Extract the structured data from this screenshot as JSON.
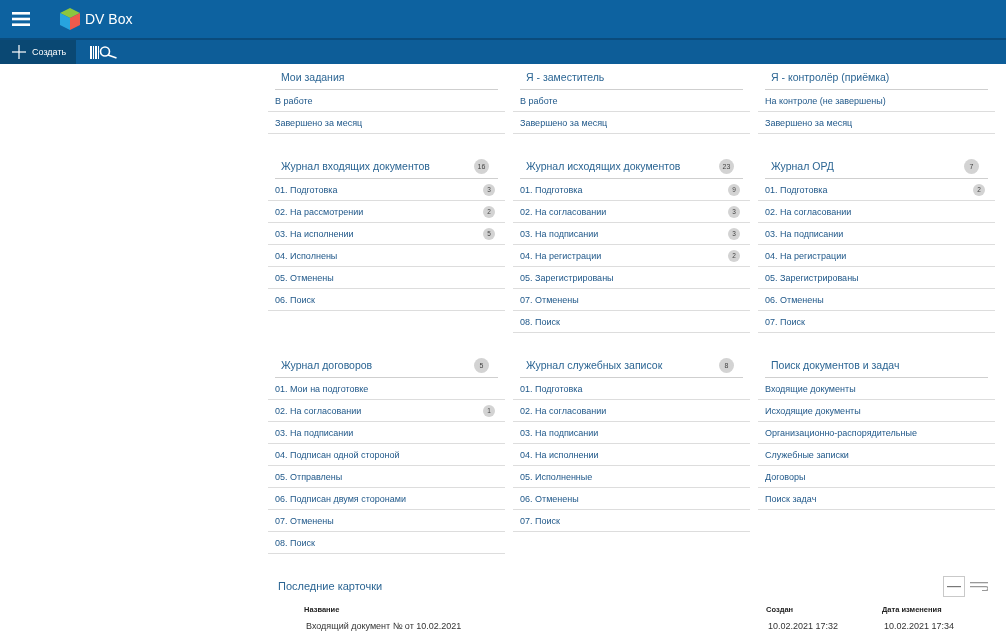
{
  "header": {
    "app_name": "DV Box"
  },
  "toolbar": {
    "create_label": "Создать"
  },
  "sections": [
    {
      "title": "Мои задания",
      "items": [
        {
          "label": "В работе"
        },
        {
          "label": "Завершено за месяц"
        }
      ]
    },
    {
      "title": "Я - заместитель",
      "items": [
        {
          "label": "В работе"
        },
        {
          "label": "Завершено за месяц"
        }
      ]
    },
    {
      "title": "Я - контролёр (приёмка)",
      "items": [
        {
          "label": "На контроле (не завершены)"
        },
        {
          "label": "Завершено за месяц"
        }
      ]
    },
    {
      "title": "Журнал входящих документов",
      "count": "16",
      "items": [
        {
          "label": "01. Подготовка",
          "count": "3"
        },
        {
          "label": "02. На рассмотрении",
          "count": "2"
        },
        {
          "label": "03. На исполнении",
          "count": "5"
        },
        {
          "label": "04. Исполнены"
        },
        {
          "label": "05. Отменены"
        },
        {
          "label": "06. Поиск"
        }
      ]
    },
    {
      "title": "Журнал исходящих документов",
      "count": "23",
      "items": [
        {
          "label": "01. Подготовка",
          "count": "9"
        },
        {
          "label": "02. На согласовании",
          "count": "3"
        },
        {
          "label": "03. На подписании",
          "count": "3"
        },
        {
          "label": "04. На регистрации",
          "count": "2"
        },
        {
          "label": "05. Зарегистрированы"
        },
        {
          "label": "07. Отменены"
        },
        {
          "label": "08. Поиск"
        }
      ]
    },
    {
      "title": "Журнал ОРД",
      "count": "7",
      "items": [
        {
          "label": "01. Подготовка",
          "count": "2"
        },
        {
          "label": "02. На согласовании"
        },
        {
          "label": "03. На подписании"
        },
        {
          "label": "04. На регистрации"
        },
        {
          "label": "05. Зарегистрированы"
        },
        {
          "label": "06. Отменены"
        },
        {
          "label": "07. Поиск"
        }
      ]
    },
    {
      "title": "Журнал договоров",
      "count": "5",
      "items": [
        {
          "label": "01. Мои на подготовке"
        },
        {
          "label": "02. На согласовании",
          "count": "1"
        },
        {
          "label": "03. На подписании"
        },
        {
          "label": "04. Подписан одной стороной"
        },
        {
          "label": "05. Отправлены"
        },
        {
          "label": "06. Подписан двумя сторонами"
        },
        {
          "label": "07. Отменены"
        },
        {
          "label": "08. Поиск"
        }
      ]
    },
    {
      "title": "Журнал служебных записок",
      "count": "8",
      "items": [
        {
          "label": "01. Подготовка"
        },
        {
          "label": "02. На согласовании"
        },
        {
          "label": "03. На подписании"
        },
        {
          "label": "04. На исполнении"
        },
        {
          "label": "05. Исполненные"
        },
        {
          "label": "06. Отменены"
        },
        {
          "label": "07. Поиск"
        }
      ]
    },
    {
      "title": "Поиск документов и задач",
      "items": [
        {
          "label": "Входящие документы"
        },
        {
          "label": "Исходящие документы"
        },
        {
          "label": "Организационно-распорядительные"
        },
        {
          "label": "Служебные записки"
        },
        {
          "label": "Договоры"
        },
        {
          "label": "Поиск задач"
        }
      ]
    }
  ],
  "recent": {
    "title": "Последние карточки",
    "columns": [
      "Название",
      "Создан",
      "Дата изменения"
    ],
    "rows": [
      [
        "Входящий документ № от 10.02.2021",
        "10.02.2021 17:32",
        "10.02.2021 17:34"
      ]
    ]
  }
}
